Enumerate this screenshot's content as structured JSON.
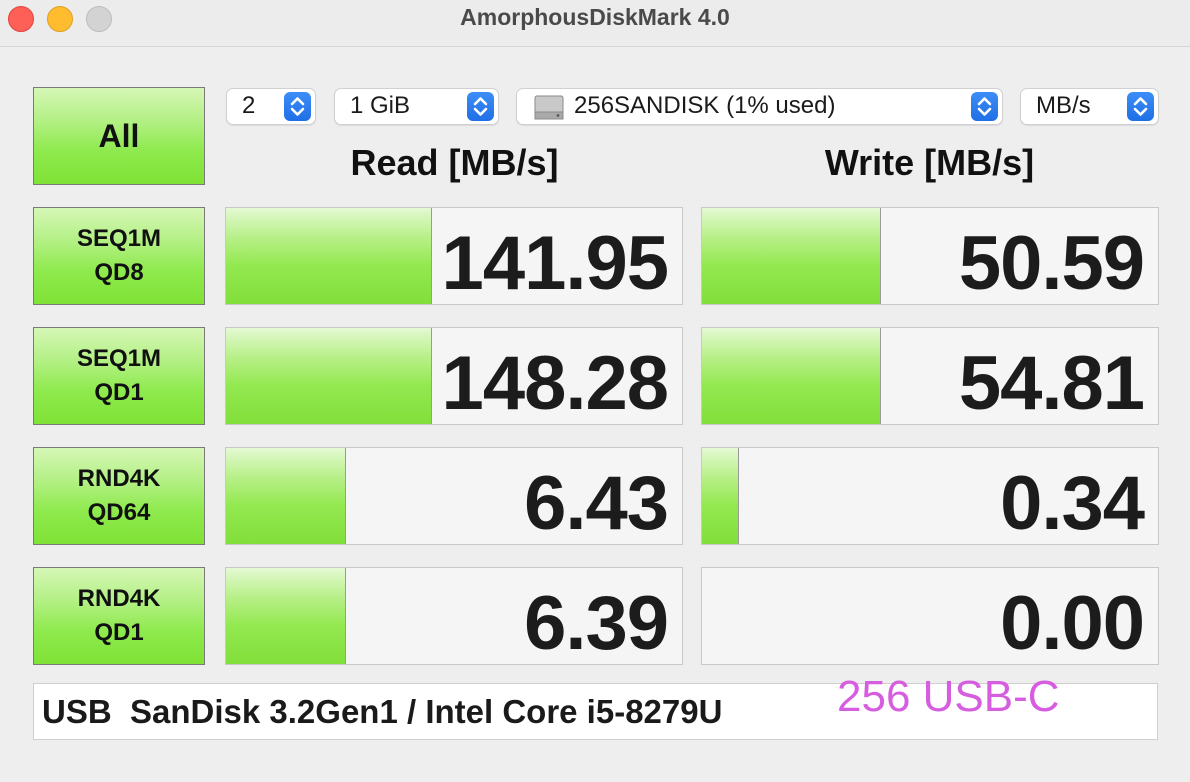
{
  "window": {
    "title": "AmorphousDiskMark 4.0"
  },
  "toolbar": {
    "all_label": "All",
    "count": "2",
    "size": "1 GiB",
    "disk": "256SANDISK (1% used)",
    "unit": "MB/s"
  },
  "headers": {
    "read": "Read [MB/s]",
    "write": "Write [MB/s]"
  },
  "tests": [
    {
      "line1": "SEQ1M",
      "line2": "QD8",
      "read": "141.95",
      "write": "50.59",
      "read_fill": 0.45,
      "write_fill": 0.39
    },
    {
      "line1": "SEQ1M",
      "line2": "QD1",
      "read": "148.28",
      "write": "54.81",
      "read_fill": 0.45,
      "write_fill": 0.39
    },
    {
      "line1": "RND4K",
      "line2": "QD64",
      "read": "6.43",
      "write": "0.34",
      "read_fill": 0.26,
      "write_fill": 0.08
    },
    {
      "line1": "RND4K",
      "line2": "QD1",
      "read": "6.39",
      "write": "0.00",
      "read_fill": 0.26,
      "write_fill": 0.0
    }
  ],
  "footer": {
    "info": "USB  SanDisk 3.2Gen1 / Intel Core i5-8279U",
    "tag": "256 USB-C"
  },
  "colors": {
    "accent": "#1f6fe6",
    "bar_green": "#82df3a",
    "tag_color": "#d65ddf"
  }
}
